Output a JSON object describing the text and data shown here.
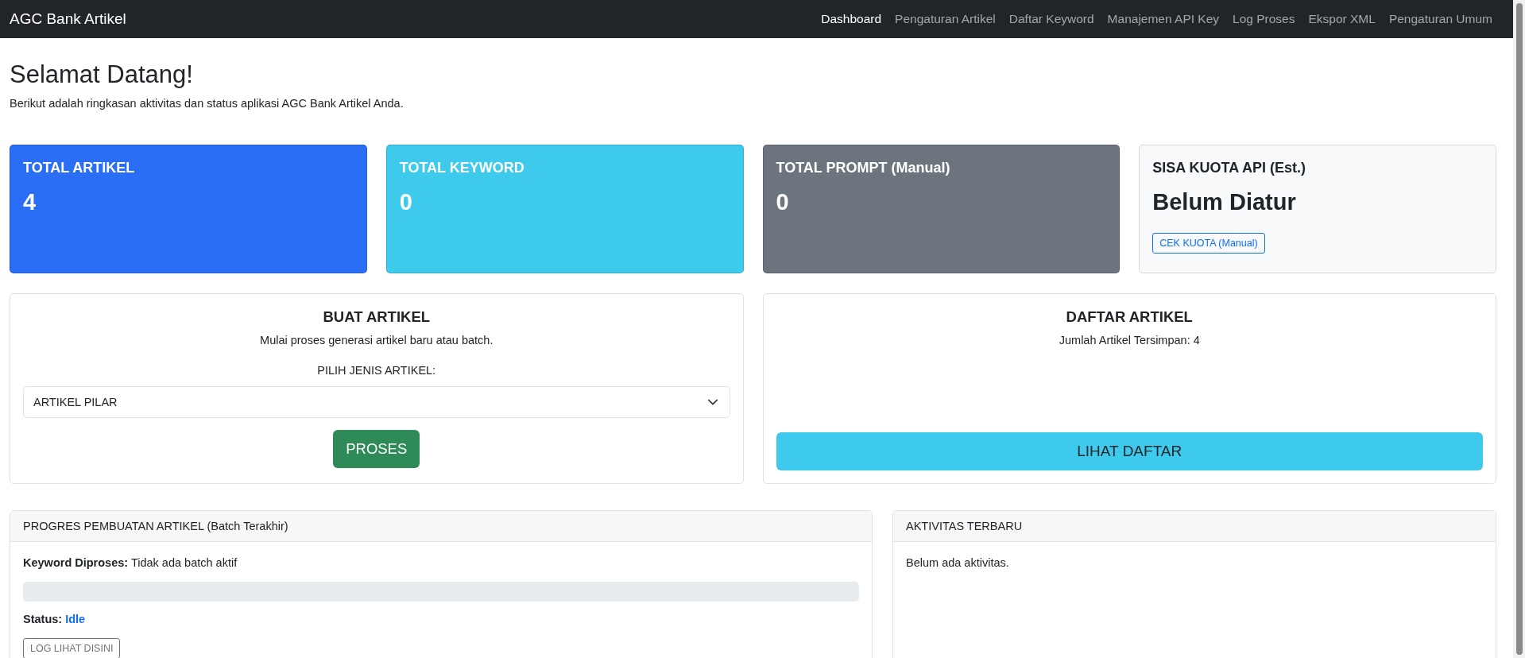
{
  "navbar": {
    "brand": "AGC Bank Artikel",
    "links": [
      {
        "label": "Dashboard",
        "selected": true
      },
      {
        "label": "Pengaturan Artikel",
        "selected": false
      },
      {
        "label": "Daftar Keyword",
        "selected": false
      },
      {
        "label": "Manajemen API Key",
        "selected": false
      },
      {
        "label": "Log Proses",
        "selected": false
      },
      {
        "label": "Ekspor XML",
        "selected": false
      },
      {
        "label": "Pengaturan Umum",
        "selected": false
      }
    ]
  },
  "heading": {
    "title": "Selamat Datang!",
    "subtitle": "Berikut adalah ringkasan aktivitas dan status aplikasi AGC Bank Artikel Anda."
  },
  "stat_cards": [
    {
      "kind": "filled",
      "color": "#2b6ef6",
      "title": "TOTAL ARTIKEL",
      "value": "4"
    },
    {
      "kind": "filled",
      "color": "#3ecaec",
      "title": "TOTAL KEYWORD",
      "value": "0"
    },
    {
      "kind": "filled",
      "color": "#6c757d",
      "title": "TOTAL PROMPT (Manual)",
      "value": "0"
    },
    {
      "kind": "outlined",
      "color": "#f8f9fa",
      "title": "SISA KUOTA API (Est.)",
      "value": "Belum Diatur",
      "button": "CEK KUOTA (Manual)"
    }
  ],
  "create_panel": {
    "title": "BUAT ARTIKEL",
    "description": "Mulai proses generasi artikel baru atau batch.",
    "select_label": "PILIH JENIS ARTIKEL:",
    "select_value": "ARTIKEL PILAR",
    "button": "PROSES"
  },
  "list_panel": {
    "title": "DAFTAR ARTIKEL",
    "description": "Jumlah Artikel Tersimpan: 4",
    "button": "LIHAT DAFTAR"
  },
  "progress_panel": {
    "header": "PROGRES PEMBUATAN ARTIKEL (Batch Terakhir)",
    "keyword_label": "Keyword Diproses:",
    "keyword_value": "Tidak ada batch aktif",
    "level": 0,
    "status_label": "Status:",
    "status_value": "Idle",
    "button": "LOG LIHAT DISINI"
  },
  "activity_panel": {
    "header": "AKTIVITAS TERBARU",
    "message": "Belum ada aktivitas."
  }
}
